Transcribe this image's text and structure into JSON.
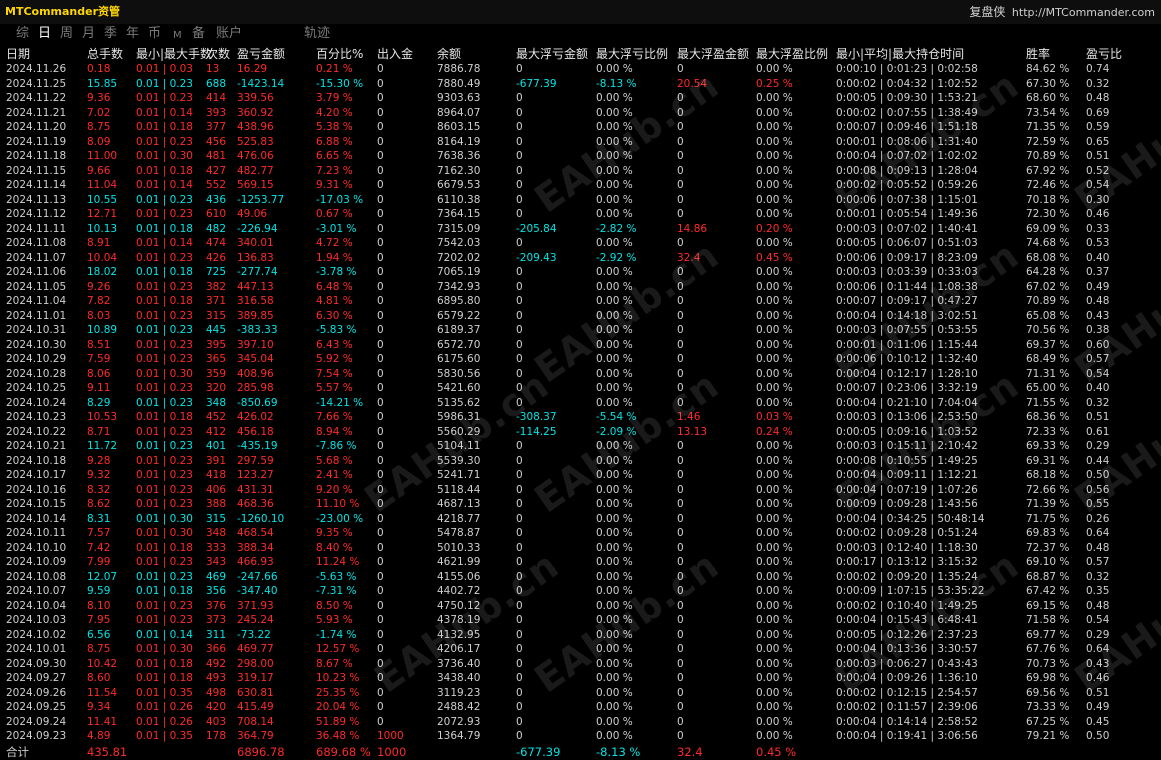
{
  "app": {
    "title": "MTCommander资管",
    "right_label": "复盘侠",
    "right_url": "http://MTCommander.com"
  },
  "toolbar": [
    {
      "label": "综",
      "active": false
    },
    {
      "label": "日",
      "active": true
    },
    {
      "label": "周",
      "active": false
    },
    {
      "label": "月",
      "active": false
    },
    {
      "label": "季",
      "active": false
    },
    {
      "label": "年",
      "active": false
    },
    {
      "label": "币",
      "active": false
    },
    {
      "label": "M",
      "active": false,
      "small": true
    },
    {
      "label": "备",
      "active": false
    },
    {
      "label": "账户",
      "active": false
    },
    {
      "label": "轨迹",
      "active": false
    }
  ],
  "columns": [
    "日期",
    "总手数",
    "最小|最大手数",
    "次数",
    "盈亏金额",
    "百分比%",
    "出入金",
    "余额",
    "最大浮亏金额",
    "最大浮亏比例",
    "最大浮盈金额",
    "最大浮盈比例",
    "最小|平均|最大持仓时间",
    "胜率",
    "盈亏比"
  ],
  "rows": [
    [
      "2024.11.26",
      "0.18",
      "0.01 | 0.03",
      "13",
      "16.29",
      "0.21 %",
      "0",
      "7886.78",
      "0",
      "0.00 %",
      "0",
      "0.00 %",
      "0:00:10 | 0:01:23 | 0:02:58",
      "84.62 %",
      "0.74"
    ],
    [
      "2024.11.25",
      "15.85",
      "0.01 | 0.23",
      "688",
      "-1423.14",
      "-15.30 %",
      "0",
      "7880.49",
      "-677.39",
      "-8.13 %",
      "20.54",
      "0.25 %",
      "0:00:02 | 0:04:32 | 1:02:52",
      "67.30 %",
      "0.32"
    ],
    [
      "2024.11.22",
      "9.36",
      "0.01 | 0.23",
      "414",
      "339.56",
      "3.79 %",
      "0",
      "9303.63",
      "0",
      "0.00 %",
      "0",
      "0.00 %",
      "0:00:05 | 0:09:30 | 1:53:21",
      "68.60 %",
      "0.48"
    ],
    [
      "2024.11.21",
      "7.02",
      "0.01 | 0.14",
      "393",
      "360.92",
      "4.20 %",
      "0",
      "8964.07",
      "0",
      "0.00 %",
      "0",
      "0.00 %",
      "0:00:02 | 0:07:55 | 1:38:49",
      "73.54 %",
      "0.69"
    ],
    [
      "2024.11.20",
      "8.75",
      "0.01 | 0.18",
      "377",
      "438.96",
      "5.38 %",
      "0",
      "8603.15",
      "0",
      "0.00 %",
      "0",
      "0.00 %",
      "0:00:07 | 0:09:46 | 1:51:18",
      "71.35 %",
      "0.59"
    ],
    [
      "2024.11.19",
      "8.09",
      "0.01 | 0.23",
      "456",
      "525.83",
      "6.88 %",
      "0",
      "8164.19",
      "0",
      "0.00 %",
      "0",
      "0.00 %",
      "0:00:01 | 0:08:06 | 1:31:40",
      "72.59 %",
      "0.65"
    ],
    [
      "2024.11.18",
      "11.00",
      "0.01 | 0.30",
      "481",
      "476.06",
      "6.65 %",
      "0",
      "7638.36",
      "0",
      "0.00 %",
      "0",
      "0.00 %",
      "0:00:04 | 0:07:02 | 1:02:02",
      "70.89 %",
      "0.51"
    ],
    [
      "2024.11.15",
      "9.66",
      "0.01 | 0.18",
      "427",
      "482.77",
      "7.23 %",
      "0",
      "7162.30",
      "0",
      "0.00 %",
      "0",
      "0.00 %",
      "0:00:08 | 0:09:13 | 1:28:04",
      "67.92 %",
      "0.52"
    ],
    [
      "2024.11.14",
      "11.04",
      "0.01 | 0.14",
      "552",
      "569.15",
      "9.31 %",
      "0",
      "6679.53",
      "0",
      "0.00 %",
      "0",
      "0.00 %",
      "0:00:02 | 0:05:52 | 0:59:26",
      "72.46 %",
      "0.54"
    ],
    [
      "2024.11.13",
      "10.55",
      "0.01 | 0.23",
      "436",
      "-1253.77",
      "-17.03 %",
      "0",
      "6110.38",
      "0",
      "0.00 %",
      "0",
      "0.00 %",
      "0:00:06 | 0:07:38 | 1:15:01",
      "70.18 %",
      "0.30"
    ],
    [
      "2024.11.12",
      "12.71",
      "0.01 | 0.23",
      "610",
      "49.06",
      "0.67 %",
      "0",
      "7364.15",
      "0",
      "0.00 %",
      "0",
      "0.00 %",
      "0:00:01 | 0:05:54 | 1:49:36",
      "72.30 %",
      "0.46"
    ],
    [
      "2024.11.11",
      "10.13",
      "0.01 | 0.18",
      "482",
      "-226.94",
      "-3.01 %",
      "0",
      "7315.09",
      "-205.84",
      "-2.82 %",
      "14.86",
      "0.20 %",
      "0:00:03 | 0:07:02 | 1:40:41",
      "69.09 %",
      "0.33"
    ],
    [
      "2024.11.08",
      "8.91",
      "0.01 | 0.14",
      "474",
      "340.01",
      "4.72 %",
      "0",
      "7542.03",
      "0",
      "0.00 %",
      "0",
      "0.00 %",
      "0:00:05 | 0:06:07 | 0:51:03",
      "74.68 %",
      "0.53"
    ],
    [
      "2024.11.07",
      "10.04",
      "0.01 | 0.23",
      "426",
      "136.83",
      "1.94 %",
      "0",
      "7202.02",
      "-209.43",
      "-2.92 %",
      "32.4",
      "0.45 %",
      "0:00:06 | 0:09:17 | 8:23:09",
      "68.08 %",
      "0.40"
    ],
    [
      "2024.11.06",
      "18.02",
      "0.01 | 0.18",
      "725",
      "-277.74",
      "-3.78 %",
      "0",
      "7065.19",
      "0",
      "0.00 %",
      "0",
      "0.00 %",
      "0:00:03 | 0:03:39 | 0:33:03",
      "64.28 %",
      "0.37"
    ],
    [
      "2024.11.05",
      "9.26",
      "0.01 | 0.23",
      "382",
      "447.13",
      "6.48 %",
      "0",
      "7342.93",
      "0",
      "0.00 %",
      "0",
      "0.00 %",
      "0:00:06 | 0:11:44 | 1:08:38",
      "67.02 %",
      "0.49"
    ],
    [
      "2024.11.04",
      "7.82",
      "0.01 | 0.18",
      "371",
      "316.58",
      "4.81 %",
      "0",
      "6895.80",
      "0",
      "0.00 %",
      "0",
      "0.00 %",
      "0:00:07 | 0:09:17 | 0:47:27",
      "70.89 %",
      "0.48"
    ],
    [
      "2024.11.01",
      "8.03",
      "0.01 | 0.23",
      "315",
      "389.85",
      "6.30 %",
      "0",
      "6579.22",
      "0",
      "0.00 %",
      "0",
      "0.00 %",
      "0:00:04 | 0:14:18 | 3:02:51",
      "65.08 %",
      "0.43"
    ],
    [
      "2024.10.31",
      "10.89",
      "0.01 | 0.23",
      "445",
      "-383.33",
      "-5.83 %",
      "0",
      "6189.37",
      "0",
      "0.00 %",
      "0",
      "0.00 %",
      "0:00:03 | 0:07:55 | 0:53:55",
      "70.56 %",
      "0.38"
    ],
    [
      "2024.10.30",
      "8.51",
      "0.01 | 0.23",
      "395",
      "397.10",
      "6.43 %",
      "0",
      "6572.70",
      "0",
      "0.00 %",
      "0",
      "0.00 %",
      "0:00:01 | 0:11:06 | 1:15:44",
      "69.37 %",
      "0.60"
    ],
    [
      "2024.10.29",
      "7.59",
      "0.01 | 0.23",
      "365",
      "345.04",
      "5.92 %",
      "0",
      "6175.60",
      "0",
      "0.00 %",
      "0",
      "0.00 %",
      "0:00:06 | 0:10:12 | 1:32:40",
      "68.49 %",
      "0.57"
    ],
    [
      "2024.10.28",
      "8.06",
      "0.01 | 0.30",
      "359",
      "408.96",
      "7.54 %",
      "0",
      "5830.56",
      "0",
      "0.00 %",
      "0",
      "0.00 %",
      "0:00:04 | 0:12:17 | 1:28:10",
      "71.31 %",
      "0.54"
    ],
    [
      "2024.10.25",
      "9.11",
      "0.01 | 0.23",
      "320",
      "285.98",
      "5.57 %",
      "0",
      "5421.60",
      "0",
      "0.00 %",
      "0",
      "0.00 %",
      "0:00:07 | 0:23:06 | 3:32:19",
      "65.00 %",
      "0.40"
    ],
    [
      "2024.10.24",
      "8.29",
      "0.01 | 0.23",
      "348",
      "-850.69",
      "-14.21 %",
      "0",
      "5135.62",
      "0",
      "0.00 %",
      "0",
      "0.00 %",
      "0:00:04 | 0:21:10 | 7:04:04",
      "71.55 %",
      "0.32"
    ],
    [
      "2024.10.23",
      "10.53",
      "0.01 | 0.18",
      "452",
      "426.02",
      "7.66 %",
      "0",
      "5986.31",
      "-308.37",
      "-5.54 %",
      "1.46",
      "0.03 %",
      "0:00:03 | 0:13:06 | 2:53:50",
      "68.36 %",
      "0.51"
    ],
    [
      "2024.10.22",
      "8.71",
      "0.01 | 0.23",
      "412",
      "456.18",
      "8.94 %",
      "0",
      "5560.29",
      "-114.25",
      "-2.09 %",
      "13.13",
      "0.24 %",
      "0:00:05 | 0:09:16 | 1:03:52",
      "72.33 %",
      "0.61"
    ],
    [
      "2024.10.21",
      "11.72",
      "0.01 | 0.23",
      "401",
      "-435.19",
      "-7.86 %",
      "0",
      "5104.11",
      "0",
      "0.00 %",
      "0",
      "0.00 %",
      "0:00:03 | 0:15:11 | 2:10:42",
      "69.33 %",
      "0.29"
    ],
    [
      "2024.10.18",
      "9.28",
      "0.01 | 0.23",
      "391",
      "297.59",
      "5.68 %",
      "0",
      "5539.30",
      "0",
      "0.00 %",
      "0",
      "0.00 %",
      "0:00:08 | 0:10:55 | 1:49:25",
      "69.31 %",
      "0.44"
    ],
    [
      "2024.10.17",
      "9.32",
      "0.01 | 0.23",
      "418",
      "123.27",
      "2.41 %",
      "0",
      "5241.71",
      "0",
      "0.00 %",
      "0",
      "0.00 %",
      "0:00:04 | 0:09:11 | 1:12:21",
      "68.18 %",
      "0.50"
    ],
    [
      "2024.10.16",
      "8.32",
      "0.01 | 0.23",
      "406",
      "431.31",
      "9.20 %",
      "0",
      "5118.44",
      "0",
      "0.00 %",
      "0",
      "0.00 %",
      "0:00:04 | 0:07:19 | 1:07:26",
      "72.66 %",
      "0.56"
    ],
    [
      "2024.10.15",
      "8.62",
      "0.01 | 0.23",
      "388",
      "468.36",
      "11.10 %",
      "0",
      "4687.13",
      "0",
      "0.00 %",
      "0",
      "0.00 %",
      "0:00:09 | 0:09:28 | 1:43:56",
      "71.39 %",
      "0.55"
    ],
    [
      "2024.10.14",
      "8.31",
      "0.01 | 0.30",
      "315",
      "-1260.10",
      "-23.00 %",
      "0",
      "4218.77",
      "0",
      "0.00 %",
      "0",
      "0.00 %",
      "0:00:04 | 0:34:25 | 50:48:14",
      "71.75 %",
      "0.26"
    ],
    [
      "2024.10.11",
      "7.57",
      "0.01 | 0.30",
      "348",
      "468.54",
      "9.35 %",
      "0",
      "5478.87",
      "0",
      "0.00 %",
      "0",
      "0.00 %",
      "0:00:02 | 0:09:28 | 0:51:24",
      "69.83 %",
      "0.64"
    ],
    [
      "2024.10.10",
      "7.42",
      "0.01 | 0.18",
      "333",
      "388.34",
      "8.40 %",
      "0",
      "5010.33",
      "0",
      "0.00 %",
      "0",
      "0.00 %",
      "0:00:03 | 0:12:40 | 1:18:30",
      "72.37 %",
      "0.48"
    ],
    [
      "2024.10.09",
      "7.99",
      "0.01 | 0.23",
      "343",
      "466.93",
      "11.24 %",
      "0",
      "4621.99",
      "0",
      "0.00 %",
      "0",
      "0.00 %",
      "0:00:17 | 0:13:12 | 3:15:32",
      "69.10 %",
      "0.57"
    ],
    [
      "2024.10.08",
      "12.07",
      "0.01 | 0.23",
      "469",
      "-247.66",
      "-5.63 %",
      "0",
      "4155.06",
      "0",
      "0.00 %",
      "0",
      "0.00 %",
      "0:00:02 | 0:09:20 | 1:35:24",
      "68.87 %",
      "0.32"
    ],
    [
      "2024.10.07",
      "9.59",
      "0.01 | 0.18",
      "356",
      "-347.40",
      "-7.31 %",
      "0",
      "4402.72",
      "0",
      "0.00 %",
      "0",
      "0.00 %",
      "0:00:09 | 1:07:15 | 53:35:22",
      "67.42 %",
      "0.35"
    ],
    [
      "2024.10.04",
      "8.10",
      "0.01 | 0.23",
      "376",
      "371.93",
      "8.50 %",
      "0",
      "4750.12",
      "0",
      "0.00 %",
      "0",
      "0.00 %",
      "0:00:02 | 0:10:40 | 1:49:25",
      "69.15 %",
      "0.48"
    ],
    [
      "2024.10.03",
      "7.95",
      "0.01 | 0.23",
      "373",
      "245.24",
      "5.93 %",
      "0",
      "4378.19",
      "0",
      "0.00 %",
      "0",
      "0.00 %",
      "0:00:04 | 0:15:43 | 6:48:41",
      "71.58 %",
      "0.54"
    ],
    [
      "2024.10.02",
      "6.56",
      "0.01 | 0.14",
      "311",
      "-73.22",
      "-1.74 %",
      "0",
      "4132.95",
      "0",
      "0.00 %",
      "0",
      "0.00 %",
      "0:00:05 | 0:12:26 | 2:37:23",
      "69.77 %",
      "0.29"
    ],
    [
      "2024.10.01",
      "8.75",
      "0.01 | 0.30",
      "366",
      "469.77",
      "12.57 %",
      "0",
      "4206.17",
      "0",
      "0.00 %",
      "0",
      "0.00 %",
      "0:00:04 | 0:13:36 | 3:30:57",
      "67.76 %",
      "0.64"
    ],
    [
      "2024.09.30",
      "10.42",
      "0.01 | 0.18",
      "492",
      "298.00",
      "8.67 %",
      "0",
      "3736.40",
      "0",
      "0.00 %",
      "0",
      "0.00 %",
      "0:00:03 | 0:06:27 | 0:43:43",
      "70.73 %",
      "0.43"
    ],
    [
      "2024.09.27",
      "8.60",
      "0.01 | 0.18",
      "493",
      "319.17",
      "10.23 %",
      "0",
      "3438.40",
      "0",
      "0.00 %",
      "0",
      "0.00 %",
      "0:00:04 | 0:09:26 | 1:36:10",
      "69.98 %",
      "0.46"
    ],
    [
      "2024.09.26",
      "11.54",
      "0.01 | 0.35",
      "498",
      "630.81",
      "25.35 %",
      "0",
      "3119.23",
      "0",
      "0.00 %",
      "0",
      "0.00 %",
      "0:00:02 | 0:12:15 | 2:54:57",
      "69.56 %",
      "0.51"
    ],
    [
      "2024.09.25",
      "9.34",
      "0.01 | 0.26",
      "420",
      "415.49",
      "20.04 %",
      "0",
      "2488.42",
      "0",
      "0.00 %",
      "0",
      "0.00 %",
      "0:00:02 | 0:11:57 | 2:39:06",
      "73.33 %",
      "0.49"
    ],
    [
      "2024.09.24",
      "11.41",
      "0.01 | 0.26",
      "403",
      "708.14",
      "51.89 %",
      "0",
      "2072.93",
      "0",
      "0.00 %",
      "0",
      "0.00 %",
      "0:00:04 | 0:14:14 | 2:58:52",
      "67.25 %",
      "0.45"
    ],
    [
      "2024.09.23",
      "4.89",
      "0.01 | 0.35",
      "178",
      "364.79",
      "36.48 %",
      "1000",
      "1364.79",
      "0",
      "0.00 %",
      "0",
      "0.00 %",
      "0:00:04 | 0:19:41 | 3:06:56",
      "79.21 %",
      "0.50"
    ]
  ],
  "footer": {
    "label": "合计",
    "total_lots": "435.81",
    "total_pnl": "6896.78",
    "total_pct": "689.68 %",
    "deposits": "1000",
    "max_float_loss": "-677.39",
    "max_float_loss_pct": "-8.13 %",
    "max_float_profit": "32.4",
    "max_float_profit_pct": "0.45 %"
  },
  "watermark_text": "EAHub.cn",
  "colors": {
    "background": "#000000",
    "title": "#ffd700",
    "profit": "#ff2a2a",
    "loss": "#00e5e5",
    "text": "#cfcfcf"
  }
}
